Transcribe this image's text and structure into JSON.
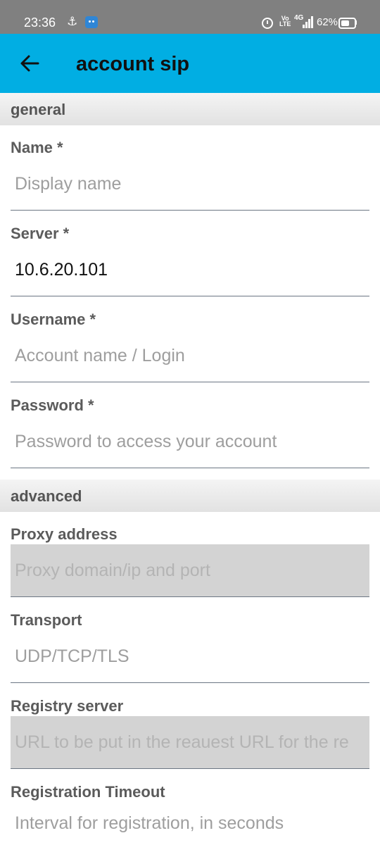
{
  "status_bar": {
    "time": "23:36",
    "volte": "Vo\nLTE",
    "network": "4G",
    "battery_percent": "62%",
    "battery_level": 0.62
  },
  "app_bar": {
    "title": "account sip",
    "back_icon": "arrow-back-icon"
  },
  "sections": {
    "general": "general",
    "advanced": "advanced"
  },
  "fields": {
    "name": {
      "label": "Name *",
      "value": "",
      "placeholder": "Display name"
    },
    "server": {
      "label": "Server *",
      "value": "10.6.20.101",
      "placeholder": ""
    },
    "username": {
      "label": "Username *",
      "value": "",
      "placeholder": "Account name / Login"
    },
    "password": {
      "label": "Password *",
      "value": "",
      "placeholder": "Password to access your account"
    },
    "proxy": {
      "label": "Proxy address",
      "value": "",
      "placeholder": "Proxy domain/ip and port"
    },
    "transport": {
      "label": "Transport",
      "value": "",
      "placeholder": "UDP/TCP/TLS"
    },
    "registry": {
      "label": "Registry server",
      "value": "",
      "placeholder": "URL to be put in the reauest URL for the re"
    },
    "timeout": {
      "label": "Registration Timeout",
      "value": "",
      "placeholder": "Interval for registration, in seconds"
    }
  },
  "colors": {
    "app_bar": "#01aee3",
    "status_bar": "#808080",
    "disabled_field": "#d3d3d3"
  }
}
